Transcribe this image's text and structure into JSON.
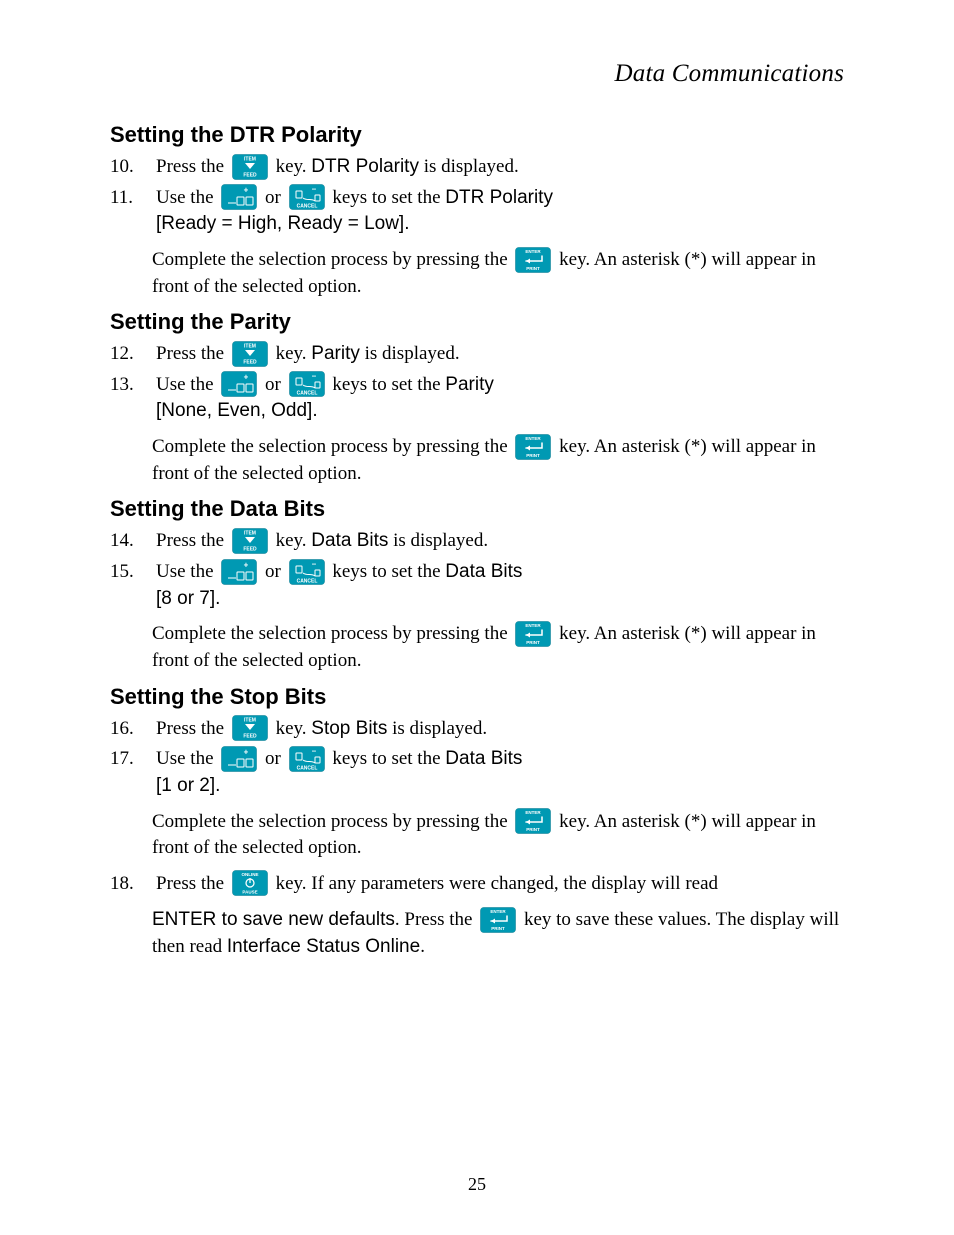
{
  "colors": {
    "teal": "#0099b3",
    "tealDark": "#00758a",
    "white": "#ffffff"
  },
  "header": {
    "title": "Data Communications"
  },
  "pageNumber": "25",
  "keys": {
    "itemFeed": {
      "top": "ITEM",
      "bottom": "FEED"
    },
    "plus": {
      "sign": "+"
    },
    "cancel": {
      "sign": "–",
      "bottom": "CANCEL"
    },
    "enterPrint": {
      "top": "ENTER",
      "bottom": "PRINT"
    },
    "onlinePause": {
      "top": "ONLINE",
      "bottom": "PAUSE"
    }
  },
  "sections": [
    {
      "heading": "Setting the DTR Polarity",
      "steps": [
        {
          "num": "10.",
          "pre": "Press the ",
          "key1": "itemFeed",
          "post1": " key. ",
          "bold1": "DTR Polarity",
          "post1b": " is displayed."
        },
        {
          "num": "11.",
          "pre": "Use the ",
          "key1": "plus",
          "mid": " or ",
          "key2": "cancel",
          "post1": " keys to set the ",
          "bold1": "DTR Polarity",
          "rangeSans": "[Ready = High, Ready = Low].",
          "sub": {
            "pre": "Complete the selection process by pressing the ",
            "key": "enterPrint",
            "post": " key. An asterisk (*) will appear in front of the selected option."
          }
        }
      ]
    },
    {
      "heading": "Setting the Parity",
      "steps": [
        {
          "num": "12.",
          "pre": "Press the ",
          "key1": "itemFeed",
          "post1": " key. ",
          "bold1": "Parity",
          "post1b": " is displayed."
        },
        {
          "num": "13.",
          "pre": "Use the ",
          "key1": "plus",
          "mid": " or ",
          "key2": "cancel",
          "post1": " keys to set the ",
          "bold1": "Parity",
          "rangeSans": "[None, Even, Odd].",
          "sub": {
            "pre": "Complete the selection process by pressing the ",
            "key": "enterPrint",
            "post": " key. An asterisk (*) will appear in front of the selected option."
          }
        }
      ]
    },
    {
      "heading": "Setting the Data Bits",
      "steps": [
        {
          "num": "14.",
          "pre": "Press the ",
          "key1": "itemFeed",
          "post1": " key. ",
          "bold1": "Data Bits",
          "post1b": " is displayed."
        },
        {
          "num": "15.",
          "pre": "Use the ",
          "key1": "plus",
          "mid": " or ",
          "key2": "cancel",
          "post1": " keys to set the ",
          "bold1": "Data Bits",
          "rangeSans": "[8 or 7].",
          "sub": {
            "pre": "Complete the selection process by pressing the ",
            "key": "enterPrint",
            "post": " key. An asterisk (*) will appear in front of the selected option."
          }
        }
      ]
    },
    {
      "heading": "Setting the Stop Bits",
      "steps": [
        {
          "num": "16.",
          "pre": "Press the ",
          "key1": "itemFeed",
          "post1": " key. ",
          "bold1": "Stop Bits",
          "post1b": " is displayed."
        },
        {
          "num": "17.",
          "pre": "Use the ",
          "key1": "plus",
          "mid": " or ",
          "key2": "cancel",
          "post1": " keys to set the ",
          "bold1": "Data Bits",
          "rangeSans": "[1 or 2].",
          "sub": {
            "pre": "Complete the selection process by pressing the ",
            "key": "enterPrint",
            "post": " key. An asterisk (*) will appear in front of the selected option."
          }
        },
        {
          "num": "18.",
          "pre": "Press the ",
          "key1": "onlinePause",
          "post1": " key. If any parameters were changed, the display will read ",
          "trailingSub": {
            "bold1": "ENTER to save new defaults",
            "mid": ". Press the ",
            "key": "enterPrint",
            "post1": " key to save these values. The display will then read ",
            "bold2": "Interface Status Online",
            "post2": "."
          }
        }
      ]
    }
  ]
}
